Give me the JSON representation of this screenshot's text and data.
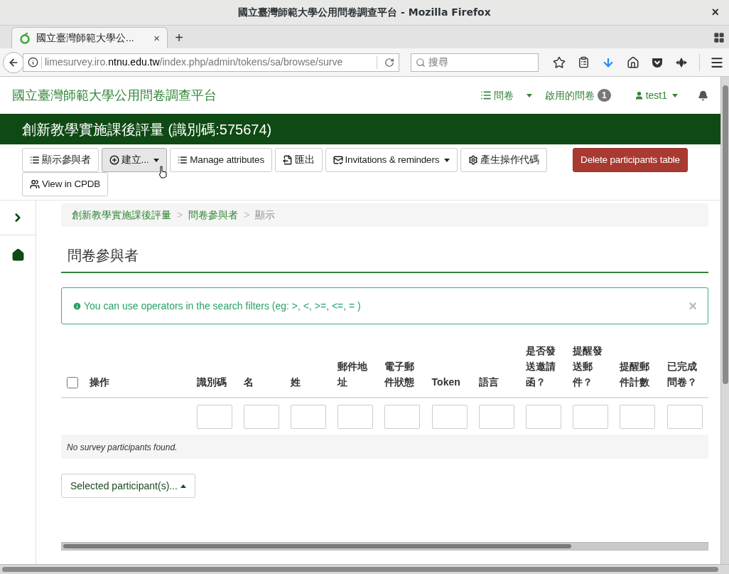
{
  "window": {
    "title": "國立臺灣師範大學公用問卷調查平台 - Mozilla Firefox",
    "close": "×"
  },
  "tabs": [
    {
      "label": "國立臺灣師範大學公...",
      "selected": true,
      "close": "×"
    }
  ],
  "new_tab": "+",
  "address_bar": {
    "host_prefix": "limesurvey.iro.",
    "host_domain": "ntnu.edu.tw",
    "path": "/index.php/admin/tokens/sa/browse/surve"
  },
  "search": {
    "placeholder": "搜尋"
  },
  "navbar": {
    "brand": "國立臺灣師範大學公用問卷調查平台",
    "surveys": "問卷",
    "active_surveys": "啟用的問卷",
    "active_count": "1",
    "user": "test1"
  },
  "survey_title": "創新教學實施課後評量 (識別碼:575674)",
  "toolbar": [
    {
      "kind": "display",
      "label": "顯示參與者",
      "dropdown": false,
      "hovered": false
    },
    {
      "kind": "create",
      "label": "建立...",
      "dropdown": true,
      "hovered": true
    },
    {
      "kind": "attributes",
      "label": "Manage attributes",
      "dropdown": false,
      "hovered": false
    },
    {
      "kind": "export",
      "label": "匯出",
      "dropdown": false,
      "hovered": false
    },
    {
      "kind": "invitations",
      "label": "Invitations & reminders",
      "dropdown": true,
      "hovered": false
    },
    {
      "kind": "tokens",
      "label": "產生操作代碼",
      "dropdown": false,
      "hovered": false
    },
    {
      "kind": "delete",
      "label": "Delete participants table",
      "dropdown": false,
      "hovered": false
    },
    {
      "kind": "cpdb",
      "label": "View in CPDB",
      "dropdown": false,
      "hovered": false
    }
  ],
  "breadcrumb": [
    {
      "label": "創新教學實施課後評量",
      "link": true
    },
    {
      "label": "問卷參與者",
      "link": true,
      "separator": ">"
    },
    {
      "label": "顯示",
      "link": false,
      "separator": ">"
    }
  ],
  "page_heading": "問卷參與者",
  "alert": {
    "text": "You can use operators in the search filters (eg: >, <, >=, <=, = )",
    "close": "×"
  },
  "table": {
    "select_all": {
      "checked": false
    },
    "columns": [
      "操作",
      "識別碼",
      "名",
      "姓",
      "郵件地址",
      "電子郵件狀態",
      "Token",
      "語言",
      "是否發送邀請函？",
      "提醒發送郵件？",
      "提醒郵件計數",
      "已完成問卷？"
    ],
    "empty_message": "No survey participants found."
  },
  "selected_action": "Selected participant(s)..."
}
